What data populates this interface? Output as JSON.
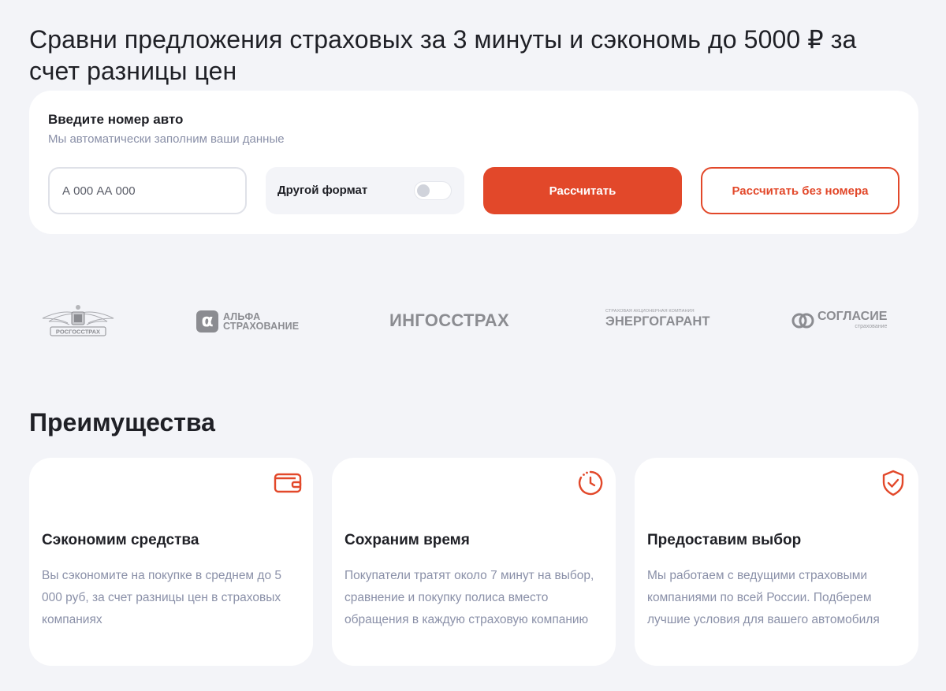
{
  "hero": {
    "title": "Сравни предложения страховых за 3 минуты и сэкономь до 5000 ₽ за счет разницы цен"
  },
  "form": {
    "label": "Введите номер авто",
    "hint": "Мы автоматически заполним ваши данные",
    "plate_placeholder": "А 000 АА 000",
    "plate_value": "",
    "other_format_label": "Другой формат",
    "other_format_enabled": false,
    "calculate_button": "Рассчитать",
    "calculate_without_number_button": "Рассчитать без номера"
  },
  "partners": {
    "rosgosstrakh": "РОСГОССТРАХ",
    "alfa_line1": "АЛЬФА",
    "alfa_line2": "СТРАХОВАНИЕ",
    "alfa_mark": "α",
    "ingosstrakh": "ИНГОССТРАХ",
    "energogarant_small": "Страховая акционерная компания",
    "energogarant": "ЭНЕРГОГАРАНТ",
    "soglasie": "СОГЛАСИЕ",
    "soglasie_sub": "страхование"
  },
  "advantages": {
    "title": "Преимущества",
    "items": [
      {
        "icon": "wallet-icon",
        "title": "Сэкономим средства",
        "text": "Вы сэкономите на покупке в среднем до 5 000 руб, за счет разницы цен в страховых компаниях"
      },
      {
        "icon": "timer-icon",
        "title": "Сохраним время",
        "text": "Покупатели тратят около 7 минут на выбор, сравнение и покупку полиса вместо обращения в каждую страховую компанию"
      },
      {
        "icon": "shield-check-icon",
        "title": "Предоставим выбор",
        "text": "Мы работаем с ведущими страховыми компаниями по всей России. Подберем лучшие условия для вашего автомобиля"
      }
    ]
  },
  "colors": {
    "accent": "#e2482a",
    "background": "#f3f4f8",
    "card": "#ffffff",
    "muted_text": "#8a90a8",
    "logo_gray": "#8b8c91"
  }
}
